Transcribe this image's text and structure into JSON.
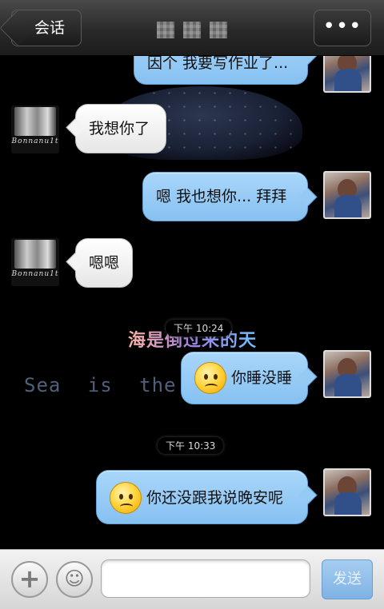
{
  "header": {
    "back_label": "会话",
    "more_label": "•••"
  },
  "messages": [
    {
      "id": "m0",
      "side": "out",
      "text": "因个 我要写作业了..."
    },
    {
      "id": "m1",
      "side": "in",
      "text": "我想你了"
    },
    {
      "id": "m2",
      "side": "out",
      "text": "嗯  我也想你...  拜拜"
    },
    {
      "id": "m3",
      "side": "in",
      "text": "嗯嗯"
    },
    {
      "id": "m4",
      "side": "out",
      "text": "你睡没睡",
      "emoji": "confused-face"
    },
    {
      "id": "m5",
      "side": "out",
      "text": "你还没跟我说晚安呢",
      "emoji": "sad-face"
    }
  ],
  "times": [
    "下午 10:24",
    "下午 10:33"
  ],
  "avatars": {
    "other_caption": "Bonnanu1t"
  },
  "background": {
    "lyric_cn": "海是倒过来的天",
    "lyric_en": "Sea is the u n"
  },
  "input_bar": {
    "message_value": "",
    "send_label": "发送"
  },
  "colors": {
    "outgoing_bubble": "#95caf5",
    "incoming_bubble": "#f2f2f2",
    "header_bg": "#2a2a2a"
  }
}
